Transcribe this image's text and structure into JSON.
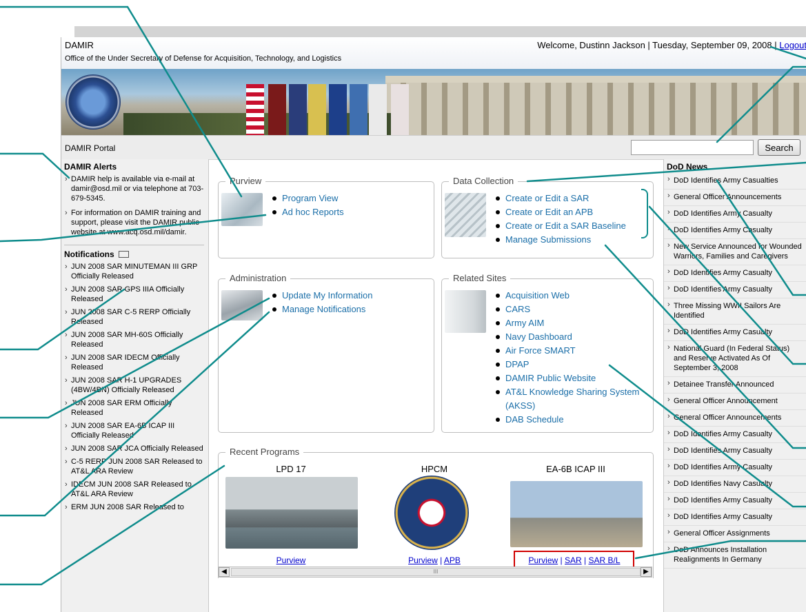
{
  "header": {
    "app_title": "DAMIR",
    "subtitle": "Office of the Under Secretary of Defense for Acquisition, Technology, and Logistics",
    "welcome": "Welcome, Dustinn Jackson | Tuesday, September 09, 2008 |",
    "logout": "Logout"
  },
  "portal": {
    "label": "DAMIR Portal",
    "search_value": "",
    "search_button": "Search"
  },
  "alerts": {
    "title": "DAMIR Alerts",
    "items": [
      "DAMIR help is available via e-mail at damir@osd.mil or via telephone at 703-679-5345.",
      "For information on DAMIR training and support, please visit the DAMIR public website at www.acq.osd.mil/damir."
    ]
  },
  "notifications": {
    "title": "Notifications",
    "items": [
      "JUN 2008 SAR MINUTEMAN III GRP Officially Released",
      "JUN 2008 SAR GPS IIIA Officially Released",
      "JUN 2008 SAR C-5 RERP Officially Released",
      "JUN 2008 SAR MH-60S Officially Released",
      "JUN 2008 SAR IDECM Officially Released",
      "JUN 2008 SAR H-1 UPGRADES (4BW/4BN) Officially Released",
      "JUN 2008 SAR ERM Officially Released",
      "JUN 2008 SAR EA-6B ICAP III Officially Released",
      "JUN 2008 SAR JCA Officially Released",
      "C-5 RERP JUN 2008 SAR Released to AT&L ARA Review",
      "IDECM JUN 2008 SAR Released to AT&L ARA Review",
      "ERM JUN 2008 SAR Released to"
    ]
  },
  "purview": {
    "title": "Purview",
    "links": [
      "Program View",
      "Ad hoc Reports"
    ]
  },
  "data_collection": {
    "title": "Data Collection",
    "links": [
      "Create or Edit a SAR",
      "Create or Edit an APB",
      "Create or Edit a SAR Baseline",
      "Manage Submissions"
    ]
  },
  "administration": {
    "title": "Administration",
    "links": [
      "Update My Information",
      "Manage Notifications"
    ]
  },
  "related_sites": {
    "title": "Related Sites",
    "links": [
      "Acquisition Web",
      "CARS",
      "Army AIM",
      "Navy Dashboard",
      "Air Force SMART",
      "DPAP",
      "DAMIR Public Website",
      "AT&L Knowledge Sharing System (AKSS)",
      "DAB Schedule"
    ]
  },
  "recent_programs": {
    "title": "Recent Programs",
    "programs": [
      {
        "name": "LPD 17",
        "links": [
          "Purview"
        ]
      },
      {
        "name": "HPCM",
        "links": [
          "Purview",
          "APB"
        ]
      },
      {
        "name": "EA-6B ICAP III",
        "links": [
          "Purview",
          "SAR",
          "SAR B/L"
        ]
      }
    ],
    "link_separator": " | ",
    "scroll_grip": "III"
  },
  "news": {
    "title": "DoD News",
    "items": [
      "DoD Identifies Army Casualties",
      "General Officer Announcements",
      "DoD Identifies Army Casualty",
      "DoD Identifies Army Casualty",
      "New Service Announced for Wounded Warriors, Families and Caregivers",
      "DoD Identifies Army Casualty",
      "DoD Identifies Army Casualty",
      "Three Missing WWII Sailors Are Identified",
      "DoD Identifies Army Casualty",
      "National Guard (In Federal Status) and Reserve Activated As Of September 3, 2008",
      "Detainee Transfer Announced",
      "General Officer Announcement",
      "General Officer Announcements",
      "DoD Identifies Army Casualty",
      "DoD Identifies Army Casualty",
      "DoD Identifies Army Casualty",
      "DoD Identifies Navy Casualty",
      "DoD Identifies Army Casualty",
      "DoD Identifies Army Casualty",
      "General Officer Assignments",
      "DoD Announces Installation Realignments In Germany"
    ]
  },
  "colors": {
    "link": "#1a6ea8",
    "callout": "#0f8c8c",
    "highlight": "#d00000"
  }
}
